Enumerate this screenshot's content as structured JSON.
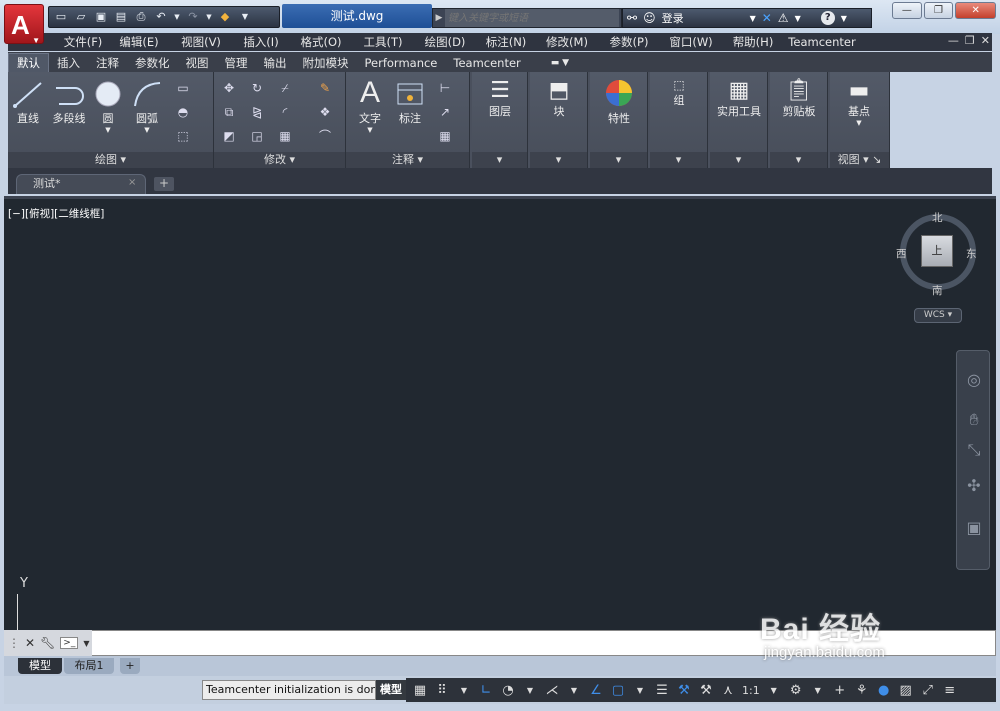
{
  "window": {
    "doc_title": "测试.dwg",
    "search_placeholder": "键入关键字或短语",
    "login_label": "登录",
    "logo_letter": "A",
    "win_buttons": [
      "—",
      "❐",
      "✕"
    ]
  },
  "menu": [
    "文件(F)",
    "编辑(E)",
    "视图(V)",
    "插入(I)",
    "格式(O)",
    "工具(T)",
    "绘图(D)",
    "标注(N)",
    "修改(M)",
    "参数(P)",
    "窗口(W)",
    "帮助(H)",
    "Teamcenter"
  ],
  "ribbon_tabs": [
    "默认",
    "插入",
    "注释",
    "参数化",
    "视图",
    "管理",
    "输出",
    "附加模块",
    "Performance",
    "Teamcenter"
  ],
  "ribbon": {
    "draw_tools": [
      "直线",
      "多段线",
      "圆",
      "圆弧"
    ],
    "draw_panel": "绘图",
    "modify_panel": "修改",
    "annotate_tools": [
      "文字",
      "标注"
    ],
    "annotate_panel": "注释",
    "layers": "图层",
    "block": "块",
    "properties": "特性",
    "group": "组",
    "utilities": "实用工具",
    "clipboard": "剪贴板",
    "base": "基点",
    "view_panel": "视图"
  },
  "file_tab": {
    "label": "测试*",
    "close": "×",
    "new": "+"
  },
  "viewport_label": "[−][俯视][二维线框]",
  "viewcube": {
    "north": "北",
    "south": "南",
    "east": "东",
    "west": "西",
    "face": "上",
    "wcs": "WCS"
  },
  "ucs": {
    "y": "Y"
  },
  "layout_tabs": [
    "模型",
    "布局1",
    "+"
  ],
  "status": {
    "message": "Teamcenter initialization is done",
    "model": "模型",
    "scale": "1:1"
  },
  "watermark": {
    "logo": "Bai 经验",
    "url": "jingyan.baidu.com"
  }
}
